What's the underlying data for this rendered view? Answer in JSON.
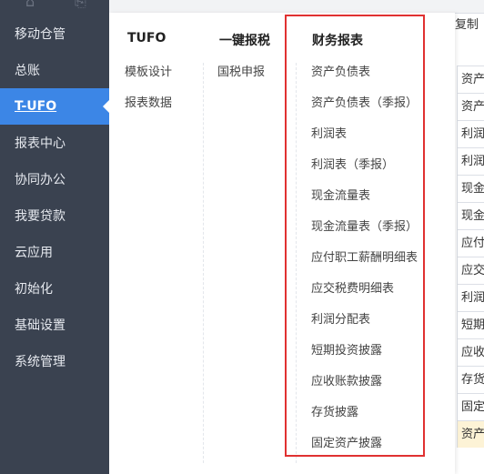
{
  "sidebar": {
    "items": [
      {
        "label": "移动仓管"
      },
      {
        "label": "总账"
      },
      {
        "label": "T-UFO"
      },
      {
        "label": "报表中心"
      },
      {
        "label": "协同办公"
      },
      {
        "label": "我要贷款"
      },
      {
        "label": "云应用"
      },
      {
        "label": "初始化"
      },
      {
        "label": "基础设置"
      },
      {
        "label": "系统管理"
      }
    ],
    "active_index": 2
  },
  "background": {
    "copy_label": "复制",
    "cells": [
      "资产",
      "资产",
      "利润",
      "利润",
      "现金",
      "现金",
      "应付",
      "应交",
      "利润",
      "短期",
      "应收",
      "存货",
      "固定",
      "资产"
    ]
  },
  "menu": {
    "columns": [
      {
        "title": "TUFO",
        "links": [
          "模板设计",
          "报表数据"
        ]
      },
      {
        "title": "一键报税",
        "links": [
          "国税申报"
        ]
      },
      {
        "title": "财务报表",
        "links": [
          "资产负债表",
          "资产负债表（季报）",
          "利润表",
          "利润表（季报）",
          "现金流量表",
          "现金流量表（季报）",
          "应付职工薪酬明细表",
          "应交税费明细表",
          "利润分配表",
          "短期投资披露",
          "应收账款披露",
          "存货披露",
          "固定资产披露"
        ]
      }
    ]
  },
  "colors": {
    "sidebar_bg": "#3a4250",
    "active_bg": "#3c86e6",
    "highlight_border": "#e03131"
  }
}
